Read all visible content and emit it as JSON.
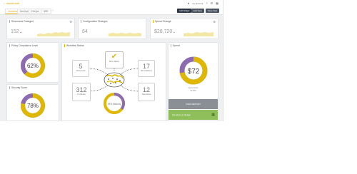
{
  "header": {
    "app_title": "dashboard",
    "user_label": "my account",
    "tabs": [
      {
        "label": "Overview"
      },
      {
        "label": "DevOps"
      },
      {
        "label": "FinOps"
      },
      {
        "label": "SRE"
      },
      {
        "label": "+"
      }
    ],
    "actions": [
      "Add Widget",
      "Edit View",
      "Save View"
    ]
  },
  "metrics": [
    {
      "title": "Resources Changed",
      "value": "152",
      "delta": "▲"
    },
    {
      "title": "Configuration Changes",
      "value": "64",
      "delta": ""
    },
    {
      "title": "Spend Change",
      "value": "$28,720",
      "delta": "▲"
    }
  ],
  "policy": {
    "title": "Policy Compliance Level",
    "value": "62%",
    "percent": 62
  },
  "security": {
    "title": "Security Score",
    "value": "78%",
    "percent": 78
  },
  "workflow": {
    "title": "Workflow Status",
    "items": [
      {
        "num": "5",
        "label": "Alerts Sent"
      },
      {
        "num": "17",
        "label": "Remediations"
      },
      {
        "num": "312",
        "label": "# of Rules"
      },
      {
        "num": "12",
        "label": "New Rules"
      }
    ],
    "center_top_label": "Drive Status",
    "center_bottom_label": "35% Maturity",
    "maturity_percent": 35
  },
  "spend": {
    "title": "Spend",
    "value": "$72",
    "percent": 72,
    "caption": "Spend Limit",
    "caption_value": "$2,500",
    "button_label": "VIEW REPORT",
    "green_label": "Set alerts at budget"
  },
  "colors": {
    "accent": "#e0b700",
    "purple": "#8c6bb0",
    "gray": "#c8c8c8"
  }
}
